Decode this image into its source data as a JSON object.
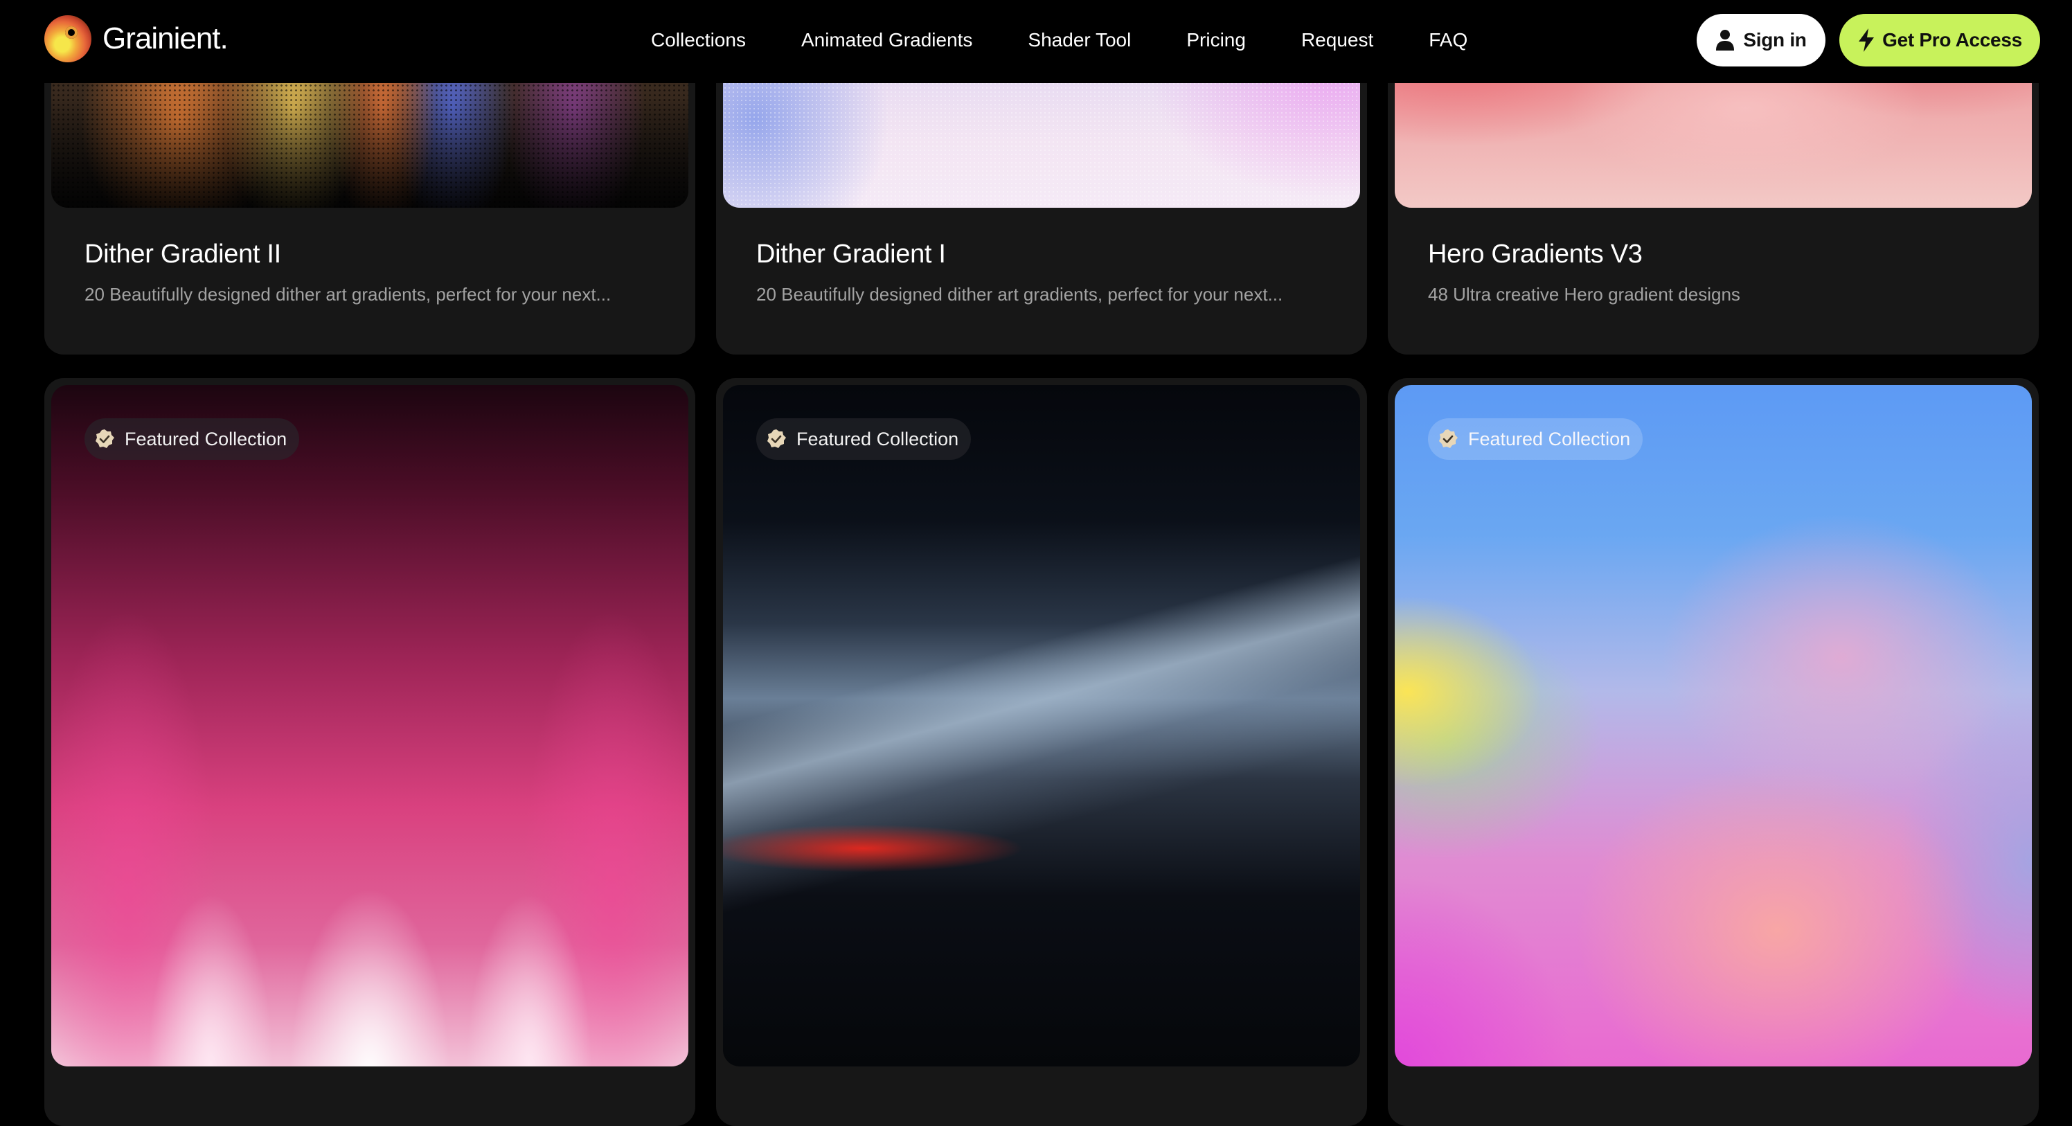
{
  "brand": {
    "name": "Grainient."
  },
  "nav": {
    "items": [
      {
        "label": "Collections"
      },
      {
        "label": "Animated Gradients"
      },
      {
        "label": "Shader Tool"
      },
      {
        "label": "Pricing"
      },
      {
        "label": "Request"
      },
      {
        "label": "FAQ"
      }
    ]
  },
  "actions": {
    "signin_label": "Sign in",
    "pro_label": "Get Pro Access"
  },
  "colors": {
    "accent": "#c8f25b",
    "background": "#000000",
    "card": "#171717"
  },
  "collections_top": [
    {
      "title": "Dither Gradient II",
      "description": "20 Beautifully designed dither art gradients, perfect for your next..."
    },
    {
      "title": "Dither Gradient I",
      "description": "20 Beautifully designed dither art gradients, perfect for your next..."
    },
    {
      "title": "Hero Gradients V3",
      "description": "48 Ultra creative Hero gradient designs"
    }
  ],
  "collections_bottom": [
    {
      "badge": "Featured Collection"
    },
    {
      "badge": "Featured Collection"
    },
    {
      "badge": "Featured Collection"
    }
  ]
}
